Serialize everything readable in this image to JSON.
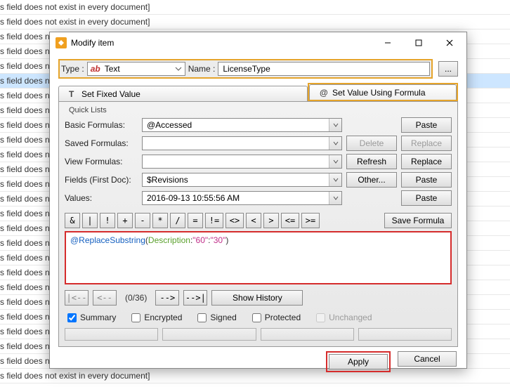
{
  "background": {
    "row_text": "s field does not exist in every document]"
  },
  "dialog": {
    "title": "Modify item",
    "type_label": "Type :",
    "type_value": "Text",
    "type_prefix": "ab",
    "name_label": "Name :",
    "name_value": "LicenseType",
    "ellipsis": "...",
    "tabs": {
      "set_fixed": "Set Fixed Value",
      "set_formula": "Set Value Using Formula"
    },
    "group": "Quick Lists",
    "rows": {
      "basic": {
        "label": "Basic Formulas:",
        "value": "@Accessed",
        "btn": "Paste"
      },
      "saved": {
        "label": "Saved Formulas:",
        "value": "",
        "btn1": "Delete",
        "btn2": "Replace"
      },
      "view": {
        "label": "View Formulas:",
        "value": "",
        "btn1": "Refresh",
        "btn2": "Replace"
      },
      "fields": {
        "label": "Fields (First Doc):",
        "value": "$Revisions",
        "btn1": "Other...",
        "btn2": "Paste"
      },
      "values": {
        "label": "Values:",
        "value": "2016-09-13 10:55:56 AM",
        "btn": "Paste"
      }
    },
    "ops": [
      "&",
      "|",
      "!",
      "+",
      "-",
      "*",
      "/",
      "=",
      "!=",
      "<>",
      "<",
      ">",
      "<=",
      ">="
    ],
    "save_formula": "Save Formula",
    "formula": {
      "fn": "@ReplaceSubstring",
      "open": "(",
      "id": "Description",
      "sep1": ":",
      "str1": "\"60\"",
      "sep2": ":",
      "str2": "\"30\"",
      "close": ")"
    },
    "nav": {
      "first": "|<--",
      "prev": "<--",
      "counter": "(0/36)",
      "next": "-->",
      "last": "-->|",
      "show": "Show History"
    },
    "checks": {
      "summary": "Summary",
      "encrypted": "Encrypted",
      "signed": "Signed",
      "protected": "Protected",
      "unchanged": "Unchanged"
    },
    "actions": {
      "apply": "Apply",
      "cancel": "Cancel"
    }
  }
}
